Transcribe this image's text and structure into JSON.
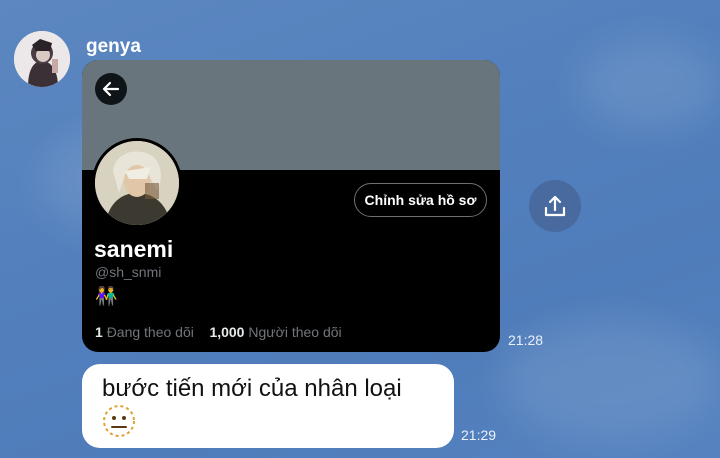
{
  "message": {
    "sender": "genya",
    "time": "21:28",
    "profile_card": {
      "edit_button": "Chỉnh sửa hồ sơ",
      "name": "sanemi",
      "handle": "@sh_snmi",
      "bio_emoji": "👫",
      "following_count": "1",
      "following_label": "Đang theo dõi",
      "followers_count": "1,000",
      "followers_label": "Người theo dõi"
    }
  },
  "reply": {
    "text": "bước tiến mới của nhân loại",
    "emoji_icon": "neutral-face-dotted-icon",
    "time": "21:29"
  },
  "colors": {
    "background": "#5380bd",
    "banner": "#69757c",
    "card": "#000000",
    "bubble": "#ffffff"
  }
}
